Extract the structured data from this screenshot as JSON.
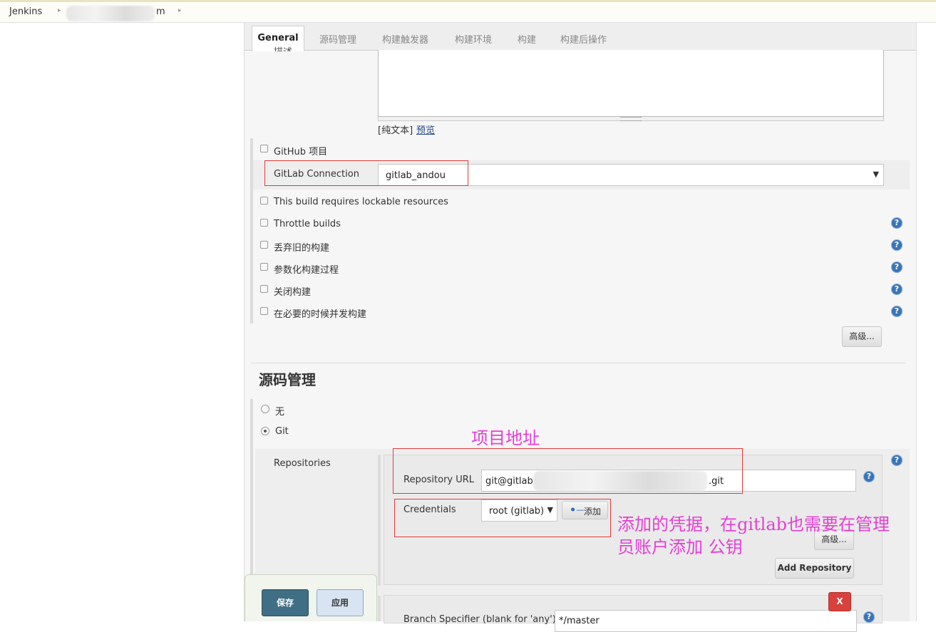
{
  "breadcrumb": {
    "root": "Jenkins",
    "job_suffix": "m"
  },
  "tabs": [
    {
      "label": "General"
    },
    {
      "label": "源码管理"
    },
    {
      "label": "构建触发器"
    },
    {
      "label": "构建环境"
    },
    {
      "label": "构建"
    },
    {
      "label": "构建后操作"
    }
  ],
  "general": {
    "description_label": "描述",
    "description_value": "",
    "plain_text": "[纯文本]",
    "preview_link": "预览",
    "github_project": "GitHub 项目",
    "gitlab_connection_label": "GitLab Connection",
    "gitlab_connection_value": "gitlab_andou",
    "options": [
      {
        "label": "This build requires lockable resources",
        "help": false
      },
      {
        "label": "Throttle builds",
        "help": true
      },
      {
        "label": "丢弃旧的构建",
        "help": true
      },
      {
        "label": "参数化构建过程",
        "help": true
      },
      {
        "label": "关闭构建",
        "help": true
      },
      {
        "label": "在必要的时候并发构建",
        "help": true
      }
    ],
    "advanced_button": "高级..."
  },
  "scm": {
    "heading": "源码管理",
    "none_label": "无",
    "git_label": "Git",
    "repositories_label": "Repositories",
    "repo_url_label": "Repository URL",
    "repo_url_prefix": "git@gitlab",
    "repo_url_suffix": ".git",
    "credentials_label": "Credentials",
    "credentials_value": "root (gitlab)",
    "add_button": "添加",
    "advanced_button": "高级...",
    "add_repository_button": "Add Repository",
    "delete_button": "X",
    "branch_label": "Branch Specifier (blank for 'any')",
    "branch_value": "*/master"
  },
  "annotations": {
    "project_address": "项目地址",
    "credentials_note_line1": "添加的凭据，在gitlab也需要在管理",
    "credentials_note_line2": "员账户添加 公钥"
  },
  "footer": {
    "save": "保存",
    "apply": "应用"
  },
  "colors": {
    "annotation": "#e63fd3",
    "highlight_box": "#e23b3b",
    "help_icon": "#3a74b8",
    "save_button": "#3f6e85"
  }
}
